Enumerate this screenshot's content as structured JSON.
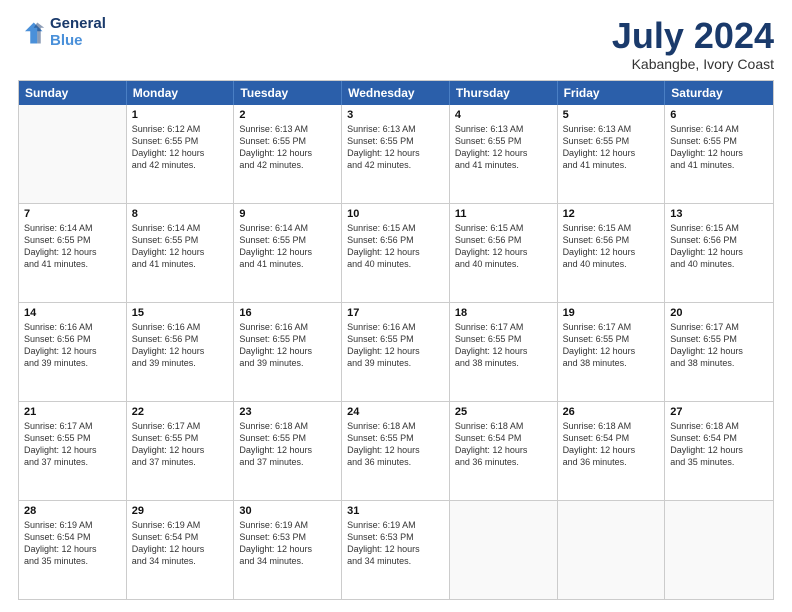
{
  "header": {
    "logo_line1": "General",
    "logo_line2": "Blue",
    "title": "July 2024",
    "subtitle": "Kabangbe, Ivory Coast"
  },
  "days": [
    "Sunday",
    "Monday",
    "Tuesday",
    "Wednesday",
    "Thursday",
    "Friday",
    "Saturday"
  ],
  "weeks": [
    [
      {
        "day": "",
        "lines": []
      },
      {
        "day": "1",
        "lines": [
          "Sunrise: 6:12 AM",
          "Sunset: 6:55 PM",
          "Daylight: 12 hours",
          "and 42 minutes."
        ]
      },
      {
        "day": "2",
        "lines": [
          "Sunrise: 6:13 AM",
          "Sunset: 6:55 PM",
          "Daylight: 12 hours",
          "and 42 minutes."
        ]
      },
      {
        "day": "3",
        "lines": [
          "Sunrise: 6:13 AM",
          "Sunset: 6:55 PM",
          "Daylight: 12 hours",
          "and 42 minutes."
        ]
      },
      {
        "day": "4",
        "lines": [
          "Sunrise: 6:13 AM",
          "Sunset: 6:55 PM",
          "Daylight: 12 hours",
          "and 41 minutes."
        ]
      },
      {
        "day": "5",
        "lines": [
          "Sunrise: 6:13 AM",
          "Sunset: 6:55 PM",
          "Daylight: 12 hours",
          "and 41 minutes."
        ]
      },
      {
        "day": "6",
        "lines": [
          "Sunrise: 6:14 AM",
          "Sunset: 6:55 PM",
          "Daylight: 12 hours",
          "and 41 minutes."
        ]
      }
    ],
    [
      {
        "day": "7",
        "lines": [
          "Sunrise: 6:14 AM",
          "Sunset: 6:55 PM",
          "Daylight: 12 hours",
          "and 41 minutes."
        ]
      },
      {
        "day": "8",
        "lines": [
          "Sunrise: 6:14 AM",
          "Sunset: 6:55 PM",
          "Daylight: 12 hours",
          "and 41 minutes."
        ]
      },
      {
        "day": "9",
        "lines": [
          "Sunrise: 6:14 AM",
          "Sunset: 6:55 PM",
          "Daylight: 12 hours",
          "and 41 minutes."
        ]
      },
      {
        "day": "10",
        "lines": [
          "Sunrise: 6:15 AM",
          "Sunset: 6:56 PM",
          "Daylight: 12 hours",
          "and 40 minutes."
        ]
      },
      {
        "day": "11",
        "lines": [
          "Sunrise: 6:15 AM",
          "Sunset: 6:56 PM",
          "Daylight: 12 hours",
          "and 40 minutes."
        ]
      },
      {
        "day": "12",
        "lines": [
          "Sunrise: 6:15 AM",
          "Sunset: 6:56 PM",
          "Daylight: 12 hours",
          "and 40 minutes."
        ]
      },
      {
        "day": "13",
        "lines": [
          "Sunrise: 6:15 AM",
          "Sunset: 6:56 PM",
          "Daylight: 12 hours",
          "and 40 minutes."
        ]
      }
    ],
    [
      {
        "day": "14",
        "lines": [
          "Sunrise: 6:16 AM",
          "Sunset: 6:56 PM",
          "Daylight: 12 hours",
          "and 39 minutes."
        ]
      },
      {
        "day": "15",
        "lines": [
          "Sunrise: 6:16 AM",
          "Sunset: 6:56 PM",
          "Daylight: 12 hours",
          "and 39 minutes."
        ]
      },
      {
        "day": "16",
        "lines": [
          "Sunrise: 6:16 AM",
          "Sunset: 6:55 PM",
          "Daylight: 12 hours",
          "and 39 minutes."
        ]
      },
      {
        "day": "17",
        "lines": [
          "Sunrise: 6:16 AM",
          "Sunset: 6:55 PM",
          "Daylight: 12 hours",
          "and 39 minutes."
        ]
      },
      {
        "day": "18",
        "lines": [
          "Sunrise: 6:17 AM",
          "Sunset: 6:55 PM",
          "Daylight: 12 hours",
          "and 38 minutes."
        ]
      },
      {
        "day": "19",
        "lines": [
          "Sunrise: 6:17 AM",
          "Sunset: 6:55 PM",
          "Daylight: 12 hours",
          "and 38 minutes."
        ]
      },
      {
        "day": "20",
        "lines": [
          "Sunrise: 6:17 AM",
          "Sunset: 6:55 PM",
          "Daylight: 12 hours",
          "and 38 minutes."
        ]
      }
    ],
    [
      {
        "day": "21",
        "lines": [
          "Sunrise: 6:17 AM",
          "Sunset: 6:55 PM",
          "Daylight: 12 hours",
          "and 37 minutes."
        ]
      },
      {
        "day": "22",
        "lines": [
          "Sunrise: 6:17 AM",
          "Sunset: 6:55 PM",
          "Daylight: 12 hours",
          "and 37 minutes."
        ]
      },
      {
        "day": "23",
        "lines": [
          "Sunrise: 6:18 AM",
          "Sunset: 6:55 PM",
          "Daylight: 12 hours",
          "and 37 minutes."
        ]
      },
      {
        "day": "24",
        "lines": [
          "Sunrise: 6:18 AM",
          "Sunset: 6:55 PM",
          "Daylight: 12 hours",
          "and 36 minutes."
        ]
      },
      {
        "day": "25",
        "lines": [
          "Sunrise: 6:18 AM",
          "Sunset: 6:54 PM",
          "Daylight: 12 hours",
          "and 36 minutes."
        ]
      },
      {
        "day": "26",
        "lines": [
          "Sunrise: 6:18 AM",
          "Sunset: 6:54 PM",
          "Daylight: 12 hours",
          "and 36 minutes."
        ]
      },
      {
        "day": "27",
        "lines": [
          "Sunrise: 6:18 AM",
          "Sunset: 6:54 PM",
          "Daylight: 12 hours",
          "and 35 minutes."
        ]
      }
    ],
    [
      {
        "day": "28",
        "lines": [
          "Sunrise: 6:19 AM",
          "Sunset: 6:54 PM",
          "Daylight: 12 hours",
          "and 35 minutes."
        ]
      },
      {
        "day": "29",
        "lines": [
          "Sunrise: 6:19 AM",
          "Sunset: 6:54 PM",
          "Daylight: 12 hours",
          "and 34 minutes."
        ]
      },
      {
        "day": "30",
        "lines": [
          "Sunrise: 6:19 AM",
          "Sunset: 6:53 PM",
          "Daylight: 12 hours",
          "and 34 minutes."
        ]
      },
      {
        "day": "31",
        "lines": [
          "Sunrise: 6:19 AM",
          "Sunset: 6:53 PM",
          "Daylight: 12 hours",
          "and 34 minutes."
        ]
      },
      {
        "day": "",
        "lines": []
      },
      {
        "day": "",
        "lines": []
      },
      {
        "day": "",
        "lines": []
      }
    ]
  ]
}
